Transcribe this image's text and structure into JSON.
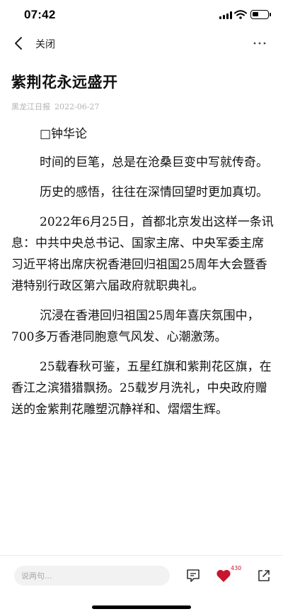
{
  "status_bar": {
    "time": "07:42",
    "icons": [
      "signal-icon",
      "wifi-icon",
      "battery-icon"
    ]
  },
  "nav": {
    "back_icon": "chevron-left-icon",
    "close_label": "关闭",
    "more_icon": "more-horizontal-icon"
  },
  "article": {
    "title": "紫荆花永远盛开",
    "source": "黑龙江日报",
    "date": "2022-06-27",
    "author_line": "□钟华论",
    "paragraphs": [
      "时间的巨笔，总是在沧桑巨变中写就传奇。",
      "历史的感悟，往往在深情回望时更加真切。",
      "2022年6月25日，首都北京发出这样一条讯息：中共中央总书记、国家主席、中央军委主席习近平将出席庆祝香港回归祖国25周年大会暨香港特别行政区第六届政府就职典礼。",
      "沉浸在香港回归祖国25周年喜庆氛围中，700多万香港同胞意气风发、心潮激荡。",
      "25载春秋可鉴，五星红旗和紫荆花区旗，在香江之滨猎猎飘扬。25载岁月洗礼，中央政府赠送的金紫荆花雕塑沉静祥和、熠熠生辉。"
    ]
  },
  "bottom_bar": {
    "comment_placeholder": "说两句...",
    "like_count": "430",
    "accent_color": "#c8152e"
  }
}
